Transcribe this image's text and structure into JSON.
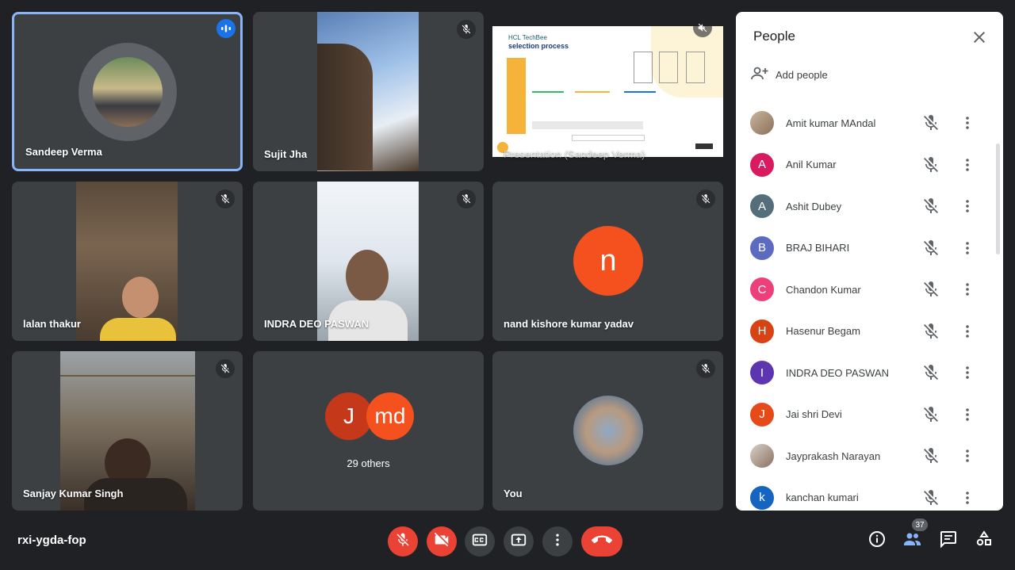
{
  "participants_grid": [
    {
      "name": "Sandeep Verma",
      "active": true
    },
    {
      "name": "Sujit Jha"
    },
    {
      "name": "Presentation (Sandeep Verma)"
    },
    {
      "name": "lalan thakur"
    },
    {
      "name": "INDRA DEO PASWAN"
    },
    {
      "name": "nand kishore kumar yadav",
      "initial": "n",
      "color": "#f4511e"
    },
    {
      "name": "Sanjay Kumar Singh"
    },
    {
      "others": "29 others",
      "initials": [
        "J",
        "md"
      ]
    },
    {
      "name": "You"
    }
  ],
  "slide": {
    "title_line1": "HCL TechBee",
    "title_line2": "selection process"
  },
  "people_panel": {
    "title": "People",
    "add_people": "Add people",
    "members": [
      {
        "name": "Amit kumar MAndal",
        "initial": "",
        "color": "#b0a28f",
        "photo": true
      },
      {
        "name": "Anil Kumar",
        "initial": "A",
        "color": "#d81b60"
      },
      {
        "name": "Ashit Dubey",
        "initial": "A",
        "color": "#546e7a"
      },
      {
        "name": "BRAJ BIHARI",
        "initial": "B",
        "color": "#5c6bc0"
      },
      {
        "name": "Chandon Kumar",
        "initial": "C",
        "color": "#ec407a"
      },
      {
        "name": "Hasenur Begam",
        "initial": "H",
        "color": "#d84315"
      },
      {
        "name": "INDRA DEO PASWAN",
        "initial": "I",
        "color": "#5e35b1"
      },
      {
        "name": "Jai shri Devi",
        "initial": "J",
        "color": "#e64a19"
      },
      {
        "name": "Jayprakash Narayan",
        "initial": "",
        "color": "#9e9e9e",
        "photo": true
      },
      {
        "name": "kanchan kumari",
        "initial": "k",
        "color": "#1565c0"
      }
    ]
  },
  "bottom_bar": {
    "meeting_code": "rxi-ygda-fop",
    "people_count": "37"
  }
}
